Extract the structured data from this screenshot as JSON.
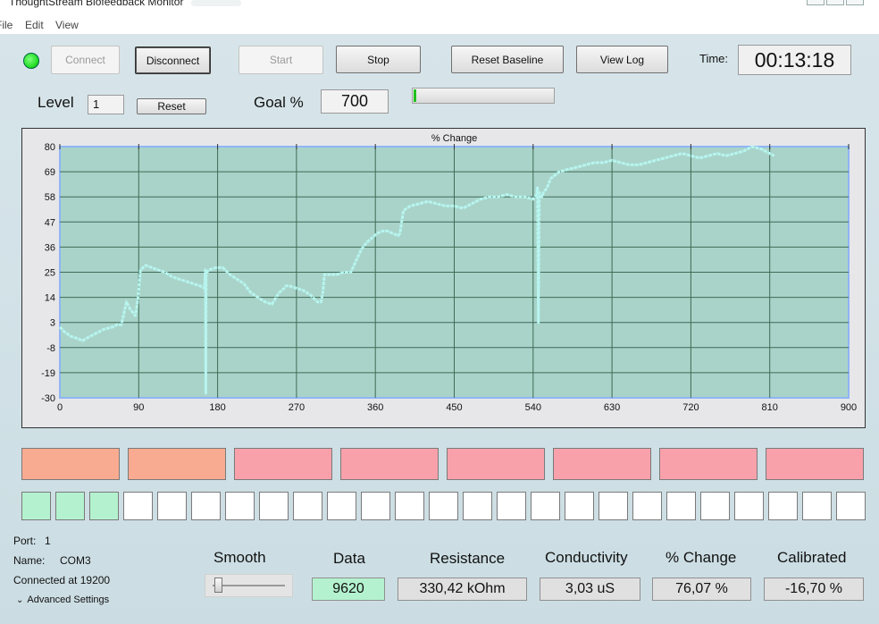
{
  "window": {
    "title": "ThoughtStream Biofeedback Monitor"
  },
  "menu": {
    "file": "File",
    "edit": "Edit",
    "view": "View"
  },
  "toolbar": {
    "connect": "Connect",
    "disconnect": "Disconnect",
    "start": "Start",
    "stop": "Stop",
    "reset_baseline": "Reset Baseline",
    "view_log": "View Log",
    "time_label": "Time:",
    "time_value": "00:13:18"
  },
  "level": {
    "label": "Level",
    "value": "1",
    "reset": "Reset"
  },
  "goal": {
    "label": "Goal %",
    "value": "700",
    "progress": 0.02
  },
  "colors": {
    "led": "#22dd22",
    "plot_bg": "#a9d3c9",
    "line": "#b7f5ef",
    "salmon": "#f9ab91",
    "pink": "#f9a1ab",
    "mint": "#b4f2cf",
    "white": "#ffffff"
  },
  "chart_data": {
    "type": "line",
    "title": "% Change",
    "xlabel": "",
    "ylabel": "",
    "xlim": [
      0,
      900
    ],
    "ylim": [
      -30,
      80
    ],
    "x_ticks": [
      "0",
      "90",
      "180",
      "270",
      "360",
      "450",
      "540",
      "630",
      "720",
      "810",
      "900"
    ],
    "y_ticks": [
      "80",
      "69",
      "58",
      "47",
      "36",
      "25",
      "14",
      "3",
      "-8",
      "-19",
      "-30"
    ],
    "grid": true,
    "x": [
      0,
      5,
      12,
      20,
      26,
      30,
      40,
      50,
      60,
      65,
      70,
      72,
      76,
      80,
      82,
      86,
      87,
      89,
      92,
      98,
      105,
      112,
      120,
      128,
      136,
      144,
      152,
      160,
      165,
      166,
      166.5,
      167,
      168,
      170,
      178,
      186,
      194,
      202,
      210,
      218,
      226,
      234,
      242,
      250,
      256,
      258,
      262,
      270,
      278,
      286,
      294,
      298,
      300,
      302,
      308,
      316,
      324,
      332,
      338,
      344,
      350,
      356,
      362,
      368,
      374,
      380,
      386,
      388,
      392,
      400,
      410,
      420,
      430,
      440,
      450,
      460,
      470,
      480,
      490,
      500,
      510,
      520,
      530,
      540,
      544,
      545,
      546,
      547,
      550,
      552,
      554,
      556,
      560,
      570,
      580,
      590,
      600,
      610,
      620,
      630,
      640,
      650,
      660,
      670,
      680,
      690,
      700,
      710,
      720,
      730,
      740,
      750,
      760,
      770,
      780,
      790,
      800,
      810,
      815
    ],
    "series": [
      {
        "values": [
          1,
          -1,
          -3,
          -4,
          -5,
          -4,
          -2,
          0,
          1,
          2,
          2,
          5,
          12,
          9,
          8,
          6,
          8,
          13,
          26,
          28,
          27,
          26,
          25,
          23,
          22,
          21,
          20,
          19,
          18,
          26,
          -28,
          24,
          25,
          26,
          27,
          27,
          24,
          22,
          20,
          16,
          14,
          12,
          11,
          16,
          18,
          19,
          19,
          18,
          17,
          15,
          12,
          12,
          16,
          24,
          24,
          24,
          25,
          25,
          30,
          35,
          38,
          40,
          42,
          43,
          43,
          42,
          41,
          42,
          52,
          54,
          55,
          56,
          55,
          54,
          54,
          53,
          55,
          57,
          58,
          58,
          59,
          58,
          58,
          57,
          59,
          62,
          3,
          60,
          58,
          60,
          61,
          62,
          66,
          69,
          70,
          71,
          72,
          73,
          73,
          74,
          73,
          72,
          72,
          73,
          74,
          75,
          76,
          77,
          76,
          75,
          76,
          77,
          76,
          77,
          78,
          80,
          79,
          77,
          76
        ]
      }
    ]
  },
  "indicators": {
    "row1": [
      "salmon",
      "salmon",
      "pink",
      "pink",
      "pink",
      "pink",
      "pink",
      "pink"
    ],
    "row2": [
      "mint",
      "mint",
      "mint",
      "white",
      "white",
      "white",
      "white",
      "white",
      "white",
      "white",
      "white",
      "white",
      "white",
      "white",
      "white",
      "white",
      "white",
      "white",
      "white",
      "white",
      "white",
      "white",
      "white",
      "white",
      "white"
    ]
  },
  "port": {
    "port_label": "Port:",
    "port_value": "1",
    "name_label": "Name:",
    "name_value": "COM3",
    "connected": "Connected at 19200",
    "advanced": "Advanced Settings"
  },
  "readouts": {
    "smooth_label": "Smooth",
    "smooth_value": 0.05,
    "data_label": "Data",
    "data_value": "9620",
    "resistance_label": "Resistance",
    "resistance_value": "330,42 kOhm",
    "conductivity_label": "Conductivity",
    "conductivity_value": "3,03 uS",
    "change_label": "% Change",
    "change_value": "76,07 %",
    "calibrated_label": "Calibrated",
    "calibrated_value": "-16,70 %"
  }
}
